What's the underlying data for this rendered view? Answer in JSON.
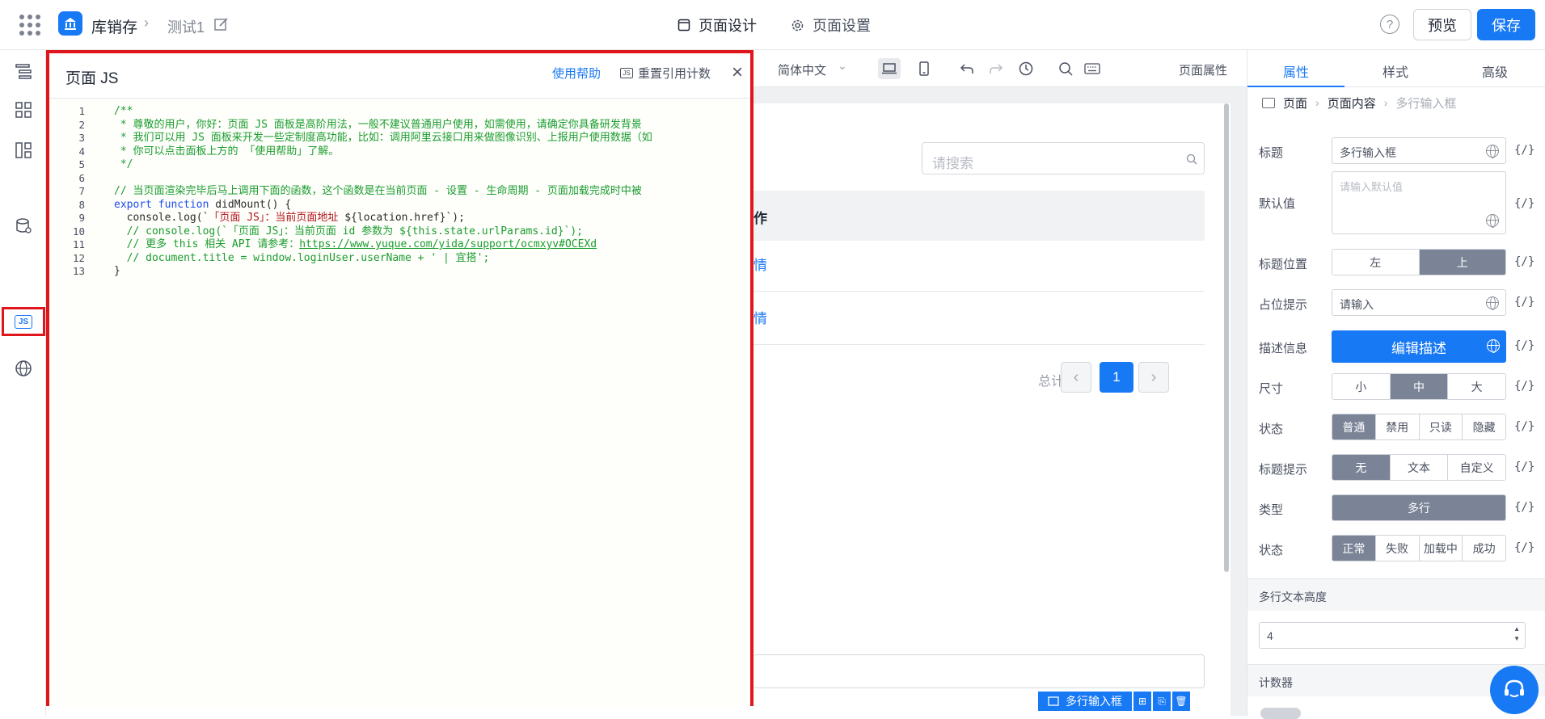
{
  "topbar": {
    "app_name": "库销存",
    "page_name": "测试1",
    "tabs": [
      {
        "label": "页面设计",
        "active": true
      },
      {
        "label": "页面设置",
        "active": false
      }
    ],
    "help_label": "?",
    "preview_label": "预览",
    "save_label": "保存"
  },
  "rail": {
    "items": [
      "outline-icon",
      "components-icon",
      "layout-icon",
      "datasource-icon",
      "js-icon",
      "i18n-icon"
    ],
    "js_badge": "JS"
  },
  "js_panel": {
    "title": "页面 JS",
    "help_link": "使用帮助",
    "reset_label": "重置引用计数",
    "mini_badge": "JS",
    "close": "×",
    "lines": [
      {
        "n": "1",
        "parts": [
          {
            "t": "/**",
            "c": "comment"
          }
        ]
      },
      {
        "n": "2",
        "parts": [
          {
            "t": " * 尊敬的用户，你好：页面 JS 面板是高阶用法，一般不建议普通用户使用，如需使用，请确定你具备研发背景",
            "c": "comment"
          }
        ]
      },
      {
        "n": "3",
        "parts": [
          {
            "t": " * 我们可以用 JS 面板来开发一些定制度高功能，比如：调用阿里云接口用来做图像识别、上报用户使用数据（如",
            "c": "comment"
          }
        ]
      },
      {
        "n": "4",
        "parts": [
          {
            "t": " * 你可以点击面板上方的 「使用帮助」了解。",
            "c": "comment"
          }
        ]
      },
      {
        "n": "5",
        "parts": [
          {
            "t": " */",
            "c": "comment"
          }
        ]
      },
      {
        "n": "6",
        "parts": []
      },
      {
        "n": "7",
        "parts": [
          {
            "t": "// 当页面渲染完毕后马上调用下面的函数，这个函数是在当前页面 - 设置 - 生命周期 - 页面加载完成时中被",
            "c": "comment"
          }
        ]
      },
      {
        "n": "8",
        "parts": [
          {
            "t": "export function",
            "c": "kw"
          },
          {
            "t": " didMount() {",
            "c": "plain"
          }
        ]
      },
      {
        "n": "9",
        "parts": [
          {
            "t": "  console.log(`",
            "c": "plain"
          },
          {
            "t": "「页面 JS」：当前页面地址",
            "c": "str"
          },
          {
            "t": " ${location.href}`);",
            "c": "plain"
          }
        ]
      },
      {
        "n": "10",
        "parts": [
          {
            "t": "  // console.log(`「页面 JS」：当前页面 id 参数为 ${this.state.urlParams.id}`);",
            "c": "comment"
          }
        ]
      },
      {
        "n": "11",
        "parts": [
          {
            "t": "  // 更多 this 相关 API 请参考：",
            "c": "comment"
          },
          {
            "t": "https://www.yuque.com/yida/support/ocmxyv#OCEXd",
            "c": "link"
          }
        ]
      },
      {
        "n": "12",
        "parts": [
          {
            "t": "  // document.title = window.loginUser.userName + ' | 宜搭';",
            "c": "comment"
          }
        ]
      },
      {
        "n": "13",
        "parts": [
          {
            "t": "}",
            "c": "plain"
          }
        ]
      }
    ]
  },
  "canvas_toolbar": {
    "language": "简体中文",
    "page_attr": "页面属性"
  },
  "canvas": {
    "search_placeholder": "请搜索",
    "table_header_op": "作",
    "row_links": [
      "情",
      "情"
    ],
    "total_label": "总计: 2",
    "prev": "‹",
    "current_page": "1",
    "next": "›",
    "selected_tag": "多行输入框"
  },
  "props": {
    "tabs": [
      {
        "label": "属性",
        "active": true
      },
      {
        "label": "样式",
        "active": false
      },
      {
        "label": "高级",
        "active": false
      }
    ],
    "breadcrumb": [
      "页面",
      "页面内容",
      "多行输入框"
    ],
    "fx": "{/}",
    "title_label": "标题",
    "title_value": "多行输入框",
    "default_label": "默认值",
    "default_placeholder": "请输入默认值",
    "title_pos_label": "标题位置",
    "title_pos_options": [
      "左",
      "上"
    ],
    "title_pos_selected": 1,
    "placeholder_label": "占位提示",
    "placeholder_value": "请输入",
    "desc_label": "描述信息",
    "desc_button": "编辑描述",
    "size_label": "尺寸",
    "size_options": [
      "小",
      "中",
      "大"
    ],
    "size_selected": 1,
    "state_label": "状态",
    "state_options": [
      "普通",
      "禁用",
      "只读",
      "隐藏"
    ],
    "state_selected": 0,
    "tip_label": "标题提示",
    "tip_options": [
      "无",
      "文本",
      "自定义"
    ],
    "tip_selected": 0,
    "type_label": "类型",
    "type_options": [
      "多行"
    ],
    "type_selected": 0,
    "status_label": "状态",
    "status_options": [
      "正常",
      "失败",
      "加载中",
      "成功"
    ],
    "status_selected": 0,
    "height_section": "多行文本高度",
    "height_value": "4",
    "counter_section": "计数器"
  },
  "colors": {
    "brand": "#1879f5",
    "highlight": "#e0161d",
    "segment_on": "#7a8496"
  }
}
